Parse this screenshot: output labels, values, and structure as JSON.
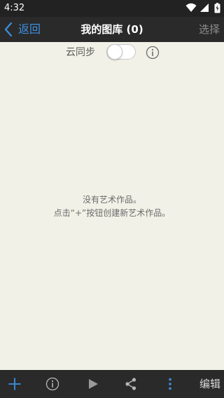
{
  "status_bar": {
    "time": "4:32",
    "icons": [
      "wifi-icon",
      "signal-icon",
      "battery-icon"
    ]
  },
  "nav": {
    "back_label": "返回",
    "title": "我的图库 (0)",
    "select_label": "选择"
  },
  "sync": {
    "label": "云同步",
    "enabled": false
  },
  "empty_state": {
    "line1": "没有艺术作品。",
    "line2": "点击“+”按钮创建新艺术作品。"
  },
  "toolbar": {
    "items": [
      "add-icon",
      "info-icon",
      "play-icon",
      "share-icon",
      "more-vertical-icon"
    ],
    "edit_label": "编辑"
  },
  "colors": {
    "accent": "#3d8fe0",
    "background": "#f2f1e8",
    "bar": "#2a2a2a",
    "status_bar": "#222222"
  }
}
